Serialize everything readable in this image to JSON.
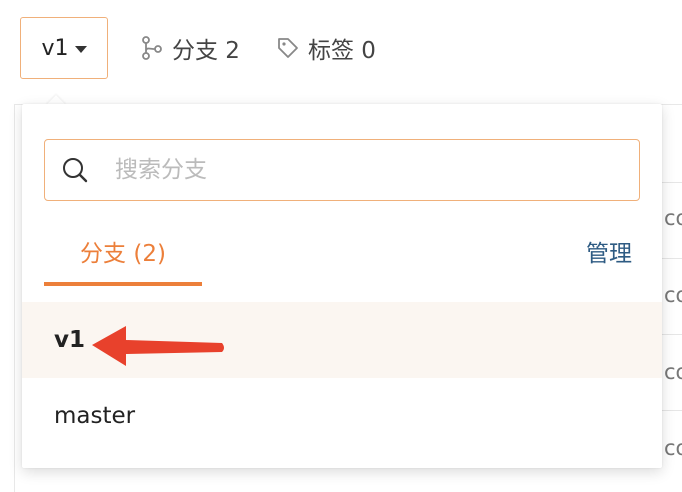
{
  "toolbar": {
    "current_branch": "v1",
    "branches_label": "分支 2",
    "tags_label": "标签 0"
  },
  "background_fragments": [
    "co",
    "co",
    "co",
    "co"
  ],
  "popover": {
    "search_placeholder": "搜索分支",
    "search_value": "",
    "tab_label": "分支 (2)",
    "manage_label": "管理",
    "branches": [
      {
        "label": "v1",
        "selected": true
      },
      {
        "label": "master",
        "selected": false
      }
    ]
  },
  "colors": {
    "accent": "#ec7f3a",
    "border_focus": "#f0b07a",
    "link": "#2e5b83",
    "selected_bg": "#fbf6f1",
    "annotation_red": "#e8412c"
  },
  "icons": {
    "branch": "git-branch-icon",
    "tag": "tag-icon",
    "search": "search-icon",
    "caret": "caret-down-icon",
    "annotation": "red-arrow-annotation"
  }
}
